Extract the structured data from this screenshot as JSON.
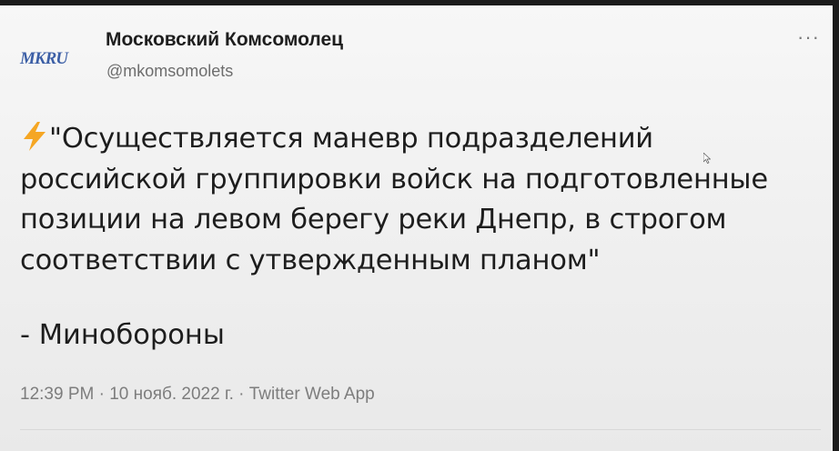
{
  "tweet": {
    "author_name": "Московский Комсомолец",
    "author_handle": "@mkomsomolets",
    "logo_text": "MKRU",
    "more_label": "···",
    "body_lines": [
      "\"Осуществляется маневр подразделений",
      "российской группировки войск на подготовленные",
      "позиции на левом берегу реки Днепр, в строгом",
      "соответствии с утвержденным планом\""
    ],
    "attribution": "- Минобороны",
    "time": "12:39 PM",
    "date": "10 нояб. 2022 г.",
    "source": "Twitter Web App",
    "separator": " · "
  },
  "icons": {
    "bolt": "lightning-bolt-icon",
    "bolt_color": "#f5a623"
  }
}
